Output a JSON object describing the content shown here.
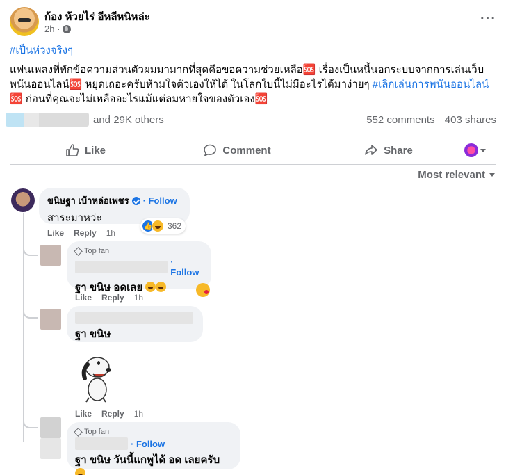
{
  "post": {
    "author": "ก้อง ห้วยไร่ อีหลีหนิหล่ะ",
    "time": "2h ·",
    "more": "···",
    "hashtag": "#เป็นห่วงจริงๆ",
    "body_part1": "แฟนเพลงที่ทักข้อความส่วนตัวผมมามากที่สุดคือขอความช่วยเหลือ🆘 เรื่องเป็นหนี้นอกระบบจากการเล่นเว็บพนันออนไลน์🆘 หยุดเถอะครับห้ามใจตัวเองให้ได้ ในโลกใบนี้ไม่มีอะไรได้มาง่ายๆ ",
    "body_tag": "#เลิกเล่นการพนันออนไลน์",
    "body_part2": " 🆘 ก่อนที่คุณจะไม่เหลืออะไรแม้แต่ลมหายใจของตัวเอง🆘"
  },
  "stats": {
    "others": "and 29K others",
    "comments": "552 comments",
    "shares": "403 shares"
  },
  "actions": {
    "like": "Like",
    "comment": "Comment",
    "share": "Share"
  },
  "sort_label": "Most relevant",
  "comments": {
    "c1": {
      "name": "ขนิษฐา เบ้าหล่อเพชร",
      "follow": "· Follow",
      "text": "สาระมาหว่ะ",
      "like": "Like",
      "reply": "Reply",
      "time": "1h",
      "reaction_count": "362"
    },
    "r1": {
      "badge": "Top fan",
      "follow": "· Follow",
      "text": "ฐา ขนิษ อดเลย",
      "like": "Like",
      "reply": "Reply",
      "time": "1h"
    },
    "r2": {
      "text": "ฐา ขนิษ",
      "like": "Like",
      "reply": "Reply",
      "time": "1h"
    },
    "r3": {
      "badge": "Top fan",
      "follow": "· Follow",
      "text": "ฐา ขนิษ วันนี้แกพูได้ อด เลยครับ"
    }
  },
  "colors": {
    "accent": "#1b74e4",
    "muted": "#65676b",
    "bubble": "#f0f2f5"
  }
}
